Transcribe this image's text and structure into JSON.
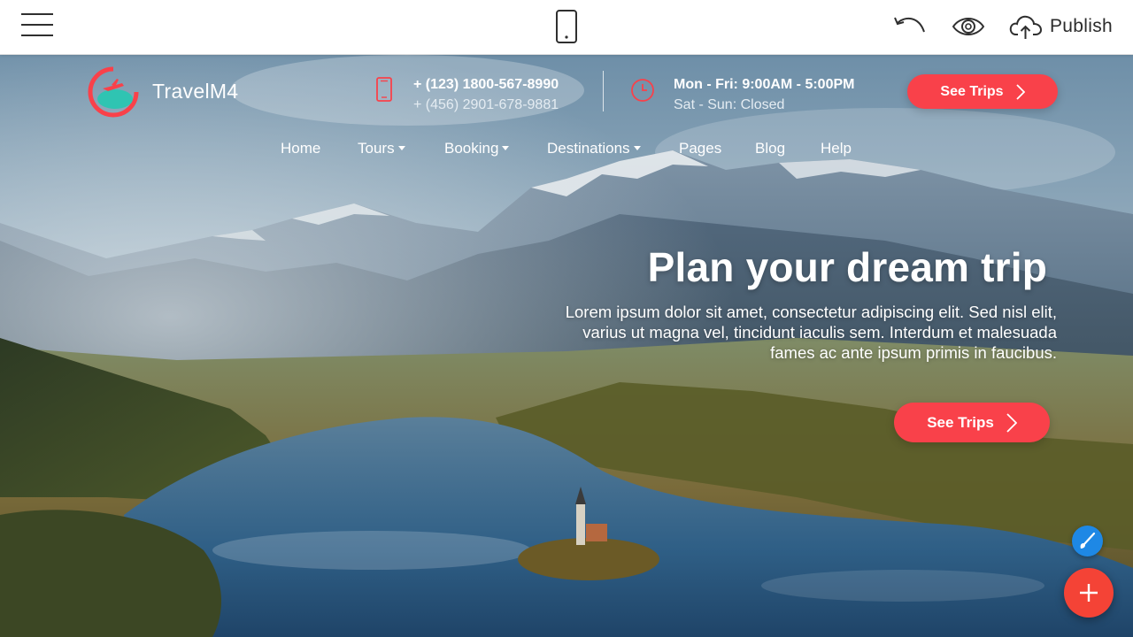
{
  "toolbar": {
    "menu_icon": "hamburger-icon",
    "device_icon": "mobile-phone-icon",
    "undo_icon": "undo-icon",
    "preview_icon": "eye-icon",
    "publish_icon": "cloud-upload-icon",
    "publish_label": "Publish"
  },
  "site": {
    "brand": "TravelM4",
    "logo_icon": "travel-logo-icon",
    "contact": {
      "phone_icon": "phone-icon",
      "phone_primary": "+ (123) 1800-567-8990",
      "phone_secondary": "+ (456) 2901-678-9881",
      "hours_icon": "clock-icon",
      "hours_weekdays": "Mon - Fri: 9:00AM - 5:00PM",
      "hours_weekend": "Sat - Sun: Closed"
    },
    "header_button": "See Trips",
    "nav": [
      {
        "label": "Home",
        "dropdown": false
      },
      {
        "label": "Tours",
        "dropdown": true
      },
      {
        "label": "Booking",
        "dropdown": true
      },
      {
        "label": "Destinations",
        "dropdown": true
      },
      {
        "label": "Pages",
        "dropdown": false
      },
      {
        "label": "Blog",
        "dropdown": false
      },
      {
        "label": "Help",
        "dropdown": false
      }
    ],
    "hero": {
      "title": "Plan your dream trip",
      "text": "Lorem ipsum dolor sit amet, consectetur adipiscing elit. Sed nisl elit, varius ut magna vel, tincidunt iaculis sem. Interdum et malesuada fames ac ante ipsum primis in faucibus.",
      "button": "See Trips"
    },
    "fab_brush_icon": "brush-icon",
    "fab_add_icon": "plus-icon"
  },
  "colors": {
    "accent": "#f9414a",
    "fab_blue": "#1e88e5",
    "fab_red": "#f44336",
    "logo_teal": "#2fc4b2"
  }
}
